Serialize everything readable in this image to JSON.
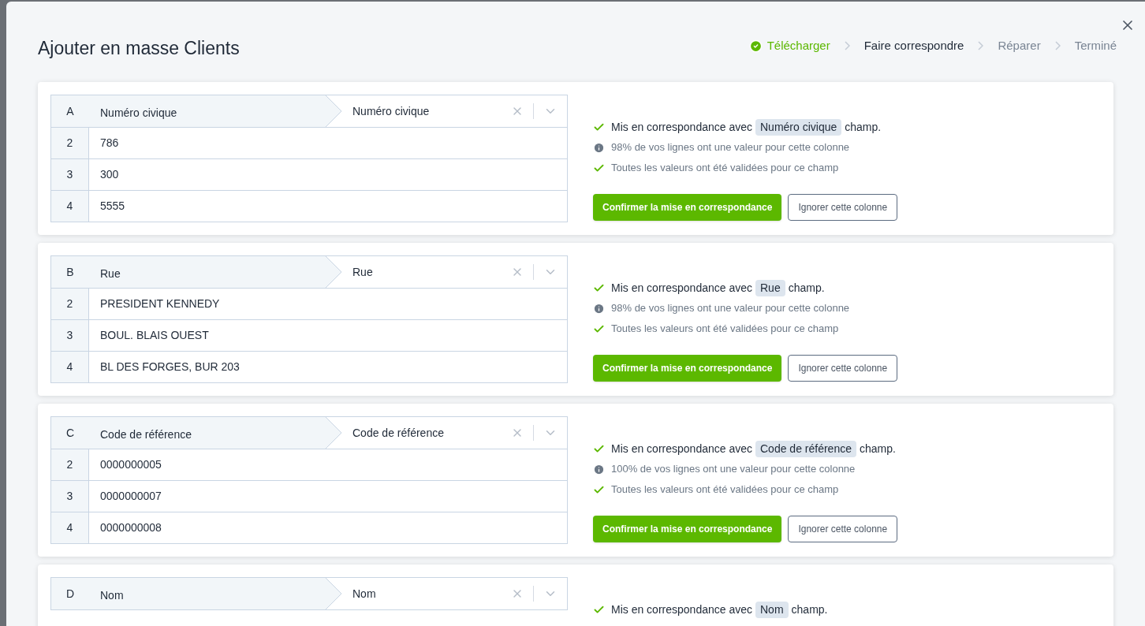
{
  "dialog": {
    "title": "Ajouter en masse Clients"
  },
  "steps": [
    {
      "label": "Télécharger",
      "done": true,
      "selected": false
    },
    {
      "label": "Faire correspondre",
      "done": false,
      "selected": true
    },
    {
      "label": "Réparer",
      "done": false,
      "selected": false
    },
    {
      "label": "Terminé",
      "done": false,
      "selected": false
    }
  ],
  "mappings": [
    {
      "letter": "A",
      "column": "Numéro civique",
      "field": "Numéro civique",
      "rows": [
        {
          "index": "2",
          "value": "786"
        },
        {
          "index": "3",
          "value": "300"
        },
        {
          "index": "4",
          "value": "5555"
        }
      ],
      "lines": [
        {
          "kind": "matched",
          "before": "Mis en correspondance avec",
          "chip": "Numéro civique",
          "after": "champ."
        },
        {
          "kind": "info",
          "text": "98% de vos lignes ont une valeur pour cette colonne"
        },
        {
          "kind": "valid",
          "text": "Toutes les valeurs ont été validées pour ce champ"
        }
      ],
      "buttons": {
        "confirm": "Confirmer la mise en correspondance",
        "ignore": "Ignorer cette colonne"
      }
    },
    {
      "letter": "B",
      "column": "Rue",
      "field": "Rue",
      "rows": [
        {
          "index": "2",
          "value": "PRESIDENT KENNEDY"
        },
        {
          "index": "3",
          "value": "BOUL. BLAIS OUEST"
        },
        {
          "index": "4",
          "value": "BL DES FORGES, BUR 203"
        }
      ],
      "lines": [
        {
          "kind": "matched",
          "before": "Mis en correspondance avec",
          "chip": "Rue",
          "after": "champ."
        },
        {
          "kind": "info",
          "text": "98% de vos lignes ont une valeur pour cette colonne"
        },
        {
          "kind": "valid",
          "text": "Toutes les valeurs ont été validées pour ce champ"
        }
      ],
      "buttons": {
        "confirm": "Confirmer la mise en correspondance",
        "ignore": "Ignorer cette colonne"
      }
    },
    {
      "letter": "C",
      "column": "Code de référence",
      "field": "Code de référence",
      "rows": [
        {
          "index": "2",
          "value": "0000000005"
        },
        {
          "index": "3",
          "value": "0000000007"
        },
        {
          "index": "4",
          "value": "0000000008"
        }
      ],
      "lines": [
        {
          "kind": "matched",
          "before": "Mis en correspondance avec",
          "chip": "Code de référence",
          "after": "champ."
        },
        {
          "kind": "info",
          "text": "100% de vos lignes ont une valeur pour cette colonne"
        },
        {
          "kind": "valid",
          "text": "Toutes les valeurs ont été validées pour ce champ"
        }
      ],
      "buttons": {
        "confirm": "Confirmer la mise en correspondance",
        "ignore": "Ignorer cette colonne"
      }
    },
    {
      "letter": "D",
      "column": "Nom",
      "field": "Nom",
      "lines": [
        {
          "kind": "matched",
          "before": "Mis en correspondance avec",
          "chip": "Nom",
          "after": "champ."
        }
      ]
    }
  ]
}
